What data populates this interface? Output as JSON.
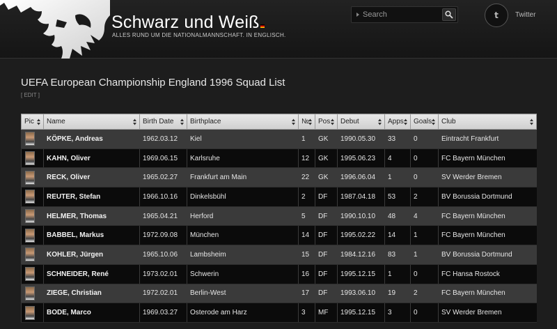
{
  "header": {
    "site_title": "Schwarz und Weiß",
    "tagline": "ALLES RUND UM DIE NATIONALMANNSCHAFT. IN ENGLISCH.",
    "search_placeholder": "Search",
    "twitter_icon_glyph": "t",
    "twitter_label": "Twitter",
    "flag_colors": [
      "#000000",
      "#dd0000",
      "#ffcc00"
    ]
  },
  "page": {
    "title": "UEFA European Championship England 1996 Squad List",
    "edit_label": "[ EDIT ]"
  },
  "table": {
    "columns": [
      "Pic",
      "Name",
      "Birth Date",
      "Birthplace",
      "№",
      "Pos",
      "Debut",
      "Apps",
      "Goals",
      "Club"
    ],
    "rows": [
      {
        "name": "KÖPKE, Andreas",
        "birth_date": "1962.03.12",
        "birthplace": "Kiel",
        "number": "1",
        "pos": "GK",
        "debut": "1990.05.30",
        "apps": "33",
        "goals": "0",
        "club": "Eintracht Frankfurt"
      },
      {
        "name": "KAHN, Oliver",
        "birth_date": "1969.06.15",
        "birthplace": "Karlsruhe",
        "number": "12",
        "pos": "GK",
        "debut": "1995.06.23",
        "apps": "4",
        "goals": "0",
        "club": "FC Bayern München"
      },
      {
        "name": "RECK, Oliver",
        "birth_date": "1965.02.27",
        "birthplace": "Frankfurt am Main",
        "number": "22",
        "pos": "GK",
        "debut": "1996.06.04",
        "apps": "1",
        "goals": "0",
        "club": "SV Werder Bremen"
      },
      {
        "name": "REUTER, Stefan",
        "birth_date": "1966.10.16",
        "birthplace": "Dinkelsbühl",
        "number": "2",
        "pos": "DF",
        "debut": "1987.04.18",
        "apps": "53",
        "goals": "2",
        "club": "BV Borussia Dortmund"
      },
      {
        "name": "HELMER, Thomas",
        "birth_date": "1965.04.21",
        "birthplace": "Herford",
        "number": "5",
        "pos": "DF",
        "debut": "1990.10.10",
        "apps": "48",
        "goals": "4",
        "club": "FC Bayern München"
      },
      {
        "name": "BABBEL, Markus",
        "birth_date": "1972.09.08",
        "birthplace": "München",
        "number": "14",
        "pos": "DF",
        "debut": "1995.02.22",
        "apps": "14",
        "goals": "1",
        "club": "FC Bayern München"
      },
      {
        "name": "KOHLER, Jürgen",
        "birth_date": "1965.10.06",
        "birthplace": "Lambsheim",
        "number": "15",
        "pos": "DF",
        "debut": "1984.12.16",
        "apps": "83",
        "goals": "1",
        "club": "BV Borussia Dortmund"
      },
      {
        "name": "SCHNEIDER, René",
        "birth_date": "1973.02.01",
        "birthplace": "Schwerin",
        "number": "16",
        "pos": "DF",
        "debut": "1995.12.15",
        "apps": "1",
        "goals": "0",
        "club": "FC Hansa Rostock"
      },
      {
        "name": "ZIEGE, Christian",
        "birth_date": "1972.02.01",
        "birthplace": "Berlin-West",
        "number": "17",
        "pos": "DF",
        "debut": "1993.06.10",
        "apps": "19",
        "goals": "2",
        "club": "FC Bayern München"
      },
      {
        "name": "BODE, Marco",
        "birth_date": "1969.03.27",
        "birthplace": "Osterode am Harz",
        "number": "3",
        "pos": "MF",
        "debut": "1995.12.15",
        "apps": "3",
        "goals": "0",
        "club": "SV Werder Bremen"
      }
    ]
  }
}
